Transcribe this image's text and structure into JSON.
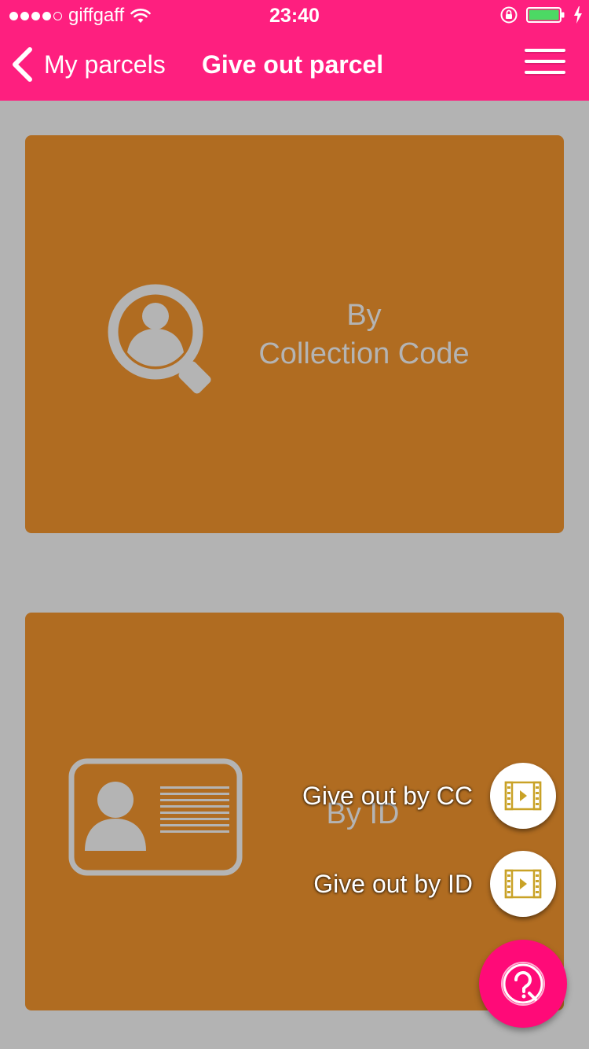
{
  "status_bar": {
    "carrier": "giffgaff",
    "time": "23:40",
    "signal_bars_filled": 4,
    "signal_bars_total": 5
  },
  "nav": {
    "back_label": "My parcels",
    "title": "Give out parcel"
  },
  "cards": {
    "collection_code": {
      "label_line1": "By",
      "label_line2": "Collection Code",
      "icon": "search-user-icon"
    },
    "id": {
      "label": "By ID",
      "icon": "id-card-icon"
    }
  },
  "fab_menu": {
    "options": [
      {
        "label": "Give out by CC",
        "icon": "video-film-icon"
      },
      {
        "label": "Give out by ID",
        "icon": "video-film-icon"
      }
    ],
    "main_icon": "help-question-icon"
  },
  "colors": {
    "brand_pink": "#fe1f7f",
    "card_brown": "#b06c21",
    "background_gray": "#b3b3b3",
    "fab_pink": "#ff0a78",
    "film_icon_gold": "#c9a227",
    "battery_green": "#4cd964"
  }
}
